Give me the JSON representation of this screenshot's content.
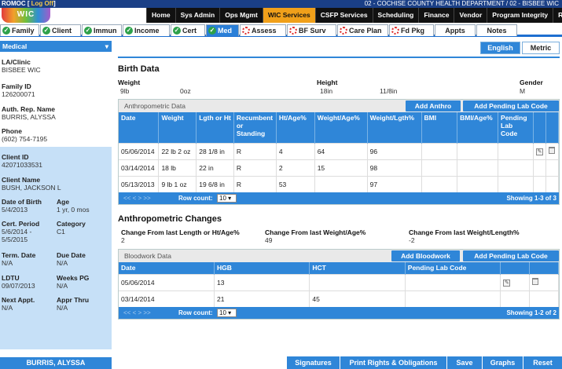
{
  "header": {
    "brand": "ROMOC",
    "logoff": "Log Off",
    "department": "02 - COCHISE COUNTY HEALTH DEPARTMENT / 02 - BISBEE WIC",
    "logo_text": "WIC"
  },
  "menu": [
    "Home",
    "Sys Admin",
    "Ops Mgmt",
    "WIC Services",
    "CSFP Services",
    "Scheduling",
    "Finance",
    "Vendor",
    "Program Integrity",
    "Reports"
  ],
  "tabs": [
    "Family",
    "Client",
    "Immun",
    "Income",
    "Cert",
    "Med",
    "Assess",
    "BF Surv",
    "Care Plan",
    "Fd Pkg",
    "Appts",
    "Notes"
  ],
  "sidebar": {
    "select": "Medical",
    "la_clinic_label": "LA/Clinic",
    "la_clinic": "BISBEE WIC",
    "family_id_label": "Family ID",
    "family_id": "126200071",
    "auth_rep_label": "Auth. Rep. Name",
    "auth_rep": "BURRIS, ALYSSA",
    "phone_label": "Phone",
    "phone": "(602) 754-7195",
    "client_id_label": "Client ID",
    "client_id": "42071033531",
    "client_name_label": "Client Name",
    "client_name": "BUSH, JACKSON L",
    "dob_label": "Date of Birth",
    "dob": "5/4/2013",
    "age_label": "Age",
    "age": "1 yr, 0 mos",
    "cert_label": "Cert. Period",
    "cert_1": "5/6/2014 -",
    "cert_2": "5/5/2015",
    "category_label": "Category",
    "category": "C1",
    "term_label": "Term. Date",
    "term": "N/A",
    "due_label": "Due Date",
    "due": "N/A",
    "ldtu_label": "LDTU",
    "ldtu": "09/07/2013",
    "weeks_label": "Weeks PG",
    "weeks": "N/A",
    "next_label": "Next Appt.",
    "next": "N/A",
    "appr_label": "Appr Thru",
    "appr": "N/A",
    "footer_name": "BURRIS, ALYSSA"
  },
  "lang": {
    "english": "English",
    "metric": "Metric"
  },
  "birth": {
    "title": "Birth Data",
    "weight_label": "Weight",
    "weight_lb": "9lb",
    "weight_oz": "0oz",
    "height_label": "Height",
    "height_in": "18in",
    "height_frac": "11/8in",
    "gender_label": "Gender",
    "gender": "M"
  },
  "anthro": {
    "title": "Anthropometric Data",
    "add_btn": "Add Anthro",
    "add_lab_btn": "Add Pending Lab Code",
    "headers": [
      "Date",
      "Weight",
      "Lgth or Ht",
      "Recumbent or Standing",
      "Ht/Age%",
      "Weight/Age%",
      "Weight/Lgth%",
      "BMI",
      "BMI/Age%",
      "Pending Lab Code"
    ],
    "rows": [
      [
        "05/06/2014",
        "22 lb 2 oz",
        "28 1/8 in",
        "R",
        "4",
        "64",
        "96",
        "",
        "",
        ""
      ],
      [
        "03/14/2014",
        "18 lb",
        "22 in",
        "R",
        "2",
        "15",
        "98",
        "",
        "",
        ""
      ],
      [
        "05/13/2013",
        "9 lb 1 oz",
        "19 6/8 in",
        "R",
        "53",
        "",
        "97",
        "",
        "",
        ""
      ]
    ],
    "pager": {
      "nav": "<< < > >>",
      "row_count": "Row count:",
      "per_page": "10",
      "showing": "Showing 1-3 of 3"
    }
  },
  "changes": {
    "title": "Anthropometric Changes",
    "l1": "Change From last Length or Ht/Age%",
    "v1": "2",
    "l2": "Change From last Weight/Age%",
    "v2": "49",
    "l3": "Change From last Weight/Length%",
    "v3": "-2"
  },
  "blood": {
    "title": "Bloodwork Data",
    "add_btn": "Add Bloodwork",
    "add_lab_btn": "Add Pending Lab Code",
    "headers": [
      "Date",
      "HGB",
      "HCT",
      "Pending Lab Code"
    ],
    "rows": [
      [
        "05/06/2014",
        "13",
        "",
        ""
      ],
      [
        "03/14/2014",
        "21",
        "45",
        ""
      ]
    ],
    "pager": {
      "nav": "<< < > >>",
      "row_count": "Row count:",
      "per_page": "10",
      "showing": "Showing 1-2 of 2"
    }
  },
  "bottom": [
    "Signatures",
    "Print Rights & Obligations",
    "Save",
    "Graphs",
    "Reset"
  ],
  "colors": {
    "primary": "#2f86d8",
    "header": "#1a3f86",
    "active_menu": "#f0a01a",
    "ok": "#2da14a",
    "error": "#d22222"
  }
}
